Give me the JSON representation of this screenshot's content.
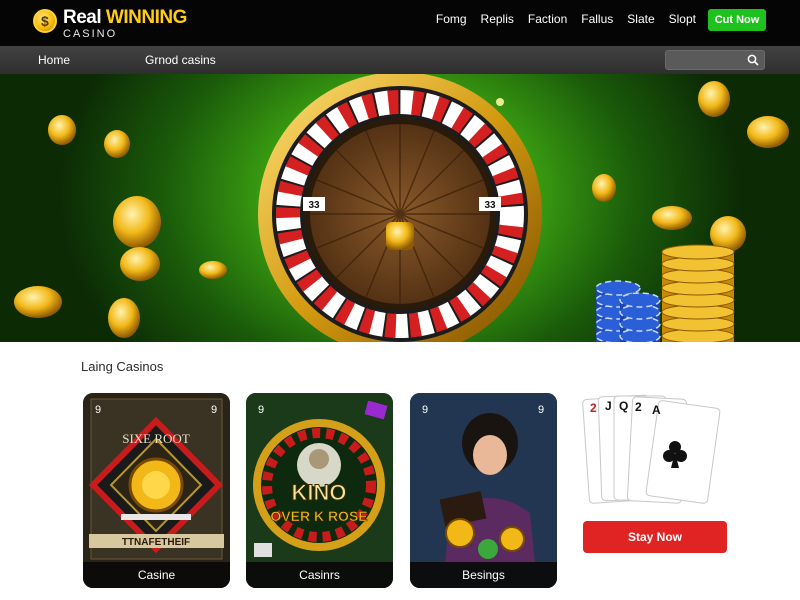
{
  "header": {
    "logo": {
      "line1_real": "Real",
      "line1_winning": "WINNING",
      "line2": "CASINO"
    },
    "nav": [
      "Fomg",
      "Replis",
      "Faction",
      "Fallus",
      "Slate",
      "Slopt"
    ],
    "cta_label": "Cut Now"
  },
  "subnav": {
    "items": [
      "Home",
      "Grnod casins"
    ],
    "search": {
      "placeholder": "",
      "icon": "search-icon"
    }
  },
  "hero": {
    "wheel_labels": [
      "33",
      "33"
    ],
    "colors": {
      "felt": "#3ea612",
      "gold": "#f5b800",
      "wheel_red": "#d42020",
      "chips": "#2a5fd8"
    }
  },
  "section": {
    "title": "Laing Casinos",
    "cards": [
      {
        "label": "Casine",
        "corner": "9",
        "art_text_top": "SIXE  ROOT",
        "art_text_bottom": "TTNAFETHEIF"
      },
      {
        "label": "Casinrs",
        "corner": "9",
        "art_text_top": "KINO",
        "art_text_bottom": "OVER K ROSE"
      },
      {
        "label": "Besings",
        "corner": "9",
        "art_text_top": "",
        "art_text_bottom": ""
      }
    ],
    "playing_cards": [
      "2",
      "J",
      "Q",
      "2",
      "A"
    ],
    "stay_button_label": "Stay Now"
  }
}
